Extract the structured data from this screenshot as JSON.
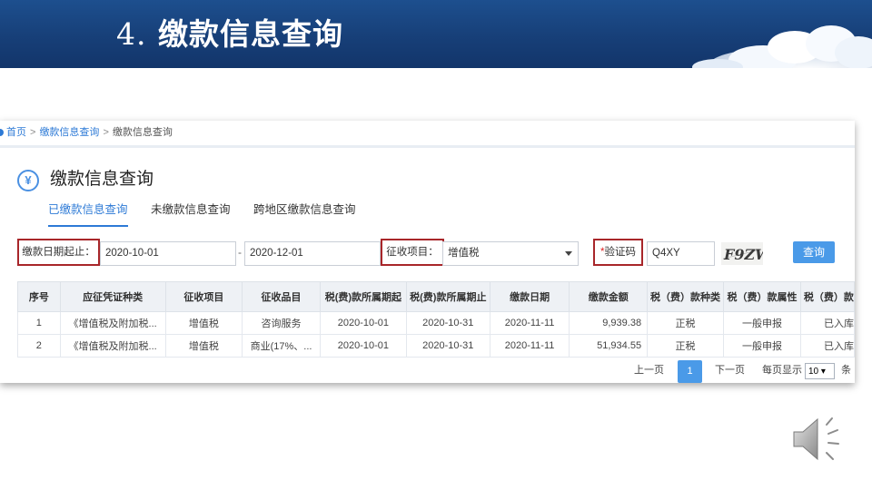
{
  "slide": {
    "title_number": "4.",
    "title_text": "缴款信息查询"
  },
  "breadcrumb": {
    "home": "首页",
    "parent": "缴款信息查询",
    "current": "缴款信息查询",
    "separator": ">"
  },
  "page": {
    "icon_symbol": "¥",
    "title": "缴款信息查询"
  },
  "tabs": [
    {
      "label": "已缴款信息查询",
      "active": true
    },
    {
      "label": "未缴款信息查询",
      "active": false
    },
    {
      "label": "跨地区缴款信息查询",
      "active": false
    }
  ],
  "filters": {
    "date_label": "缴款日期起止：",
    "date_start": "2020-10-01",
    "date_sep": "-",
    "date_end": "2020-12-01",
    "item_label": "征收项目：",
    "item_value": "增值税",
    "captcha_required_mark": "*",
    "captcha_label": "验证码",
    "captcha_value": "Q4XY",
    "captcha_image_text": "F9ZW",
    "query_button": "查询"
  },
  "table": {
    "headers": [
      "序号",
      "应征凭证种类",
      "征收项目",
      "征收品目",
      "税(费)款所属期起",
      "税(费)款所属期止",
      "缴款日期",
      "缴款金额",
      "税（费）款种类",
      "税（费）款属性",
      "税（费）款"
    ],
    "rows": [
      [
        "1",
        "《增值税及附加税...",
        "增值税",
        "咨询服务",
        "2020-10-01",
        "2020-10-31",
        "2020-11-11",
        "9,939.38",
        "正税",
        "一般申报",
        "已入库"
      ],
      [
        "2",
        "《增值税及附加税...",
        "增值税",
        "商业(17%、...",
        "2020-10-01",
        "2020-10-31",
        "2020-11-11",
        "51,934.55",
        "正税",
        "一般申报",
        "已入库"
      ]
    ]
  },
  "pagination": {
    "prev": "上一页",
    "current": "1",
    "next": "下一页",
    "per_page_label": "每页显示",
    "per_page_value": "10 ▾",
    "tail": "条"
  },
  "colors": {
    "banner": "#173f78",
    "accent": "#2d7ad6",
    "highlight_box": "#a8262a",
    "button": "#4a9ae8"
  },
  "icons": [
    "yen-icon",
    "dropdown-arrow-icon",
    "speaker-icon",
    "cloud-decoration"
  ]
}
